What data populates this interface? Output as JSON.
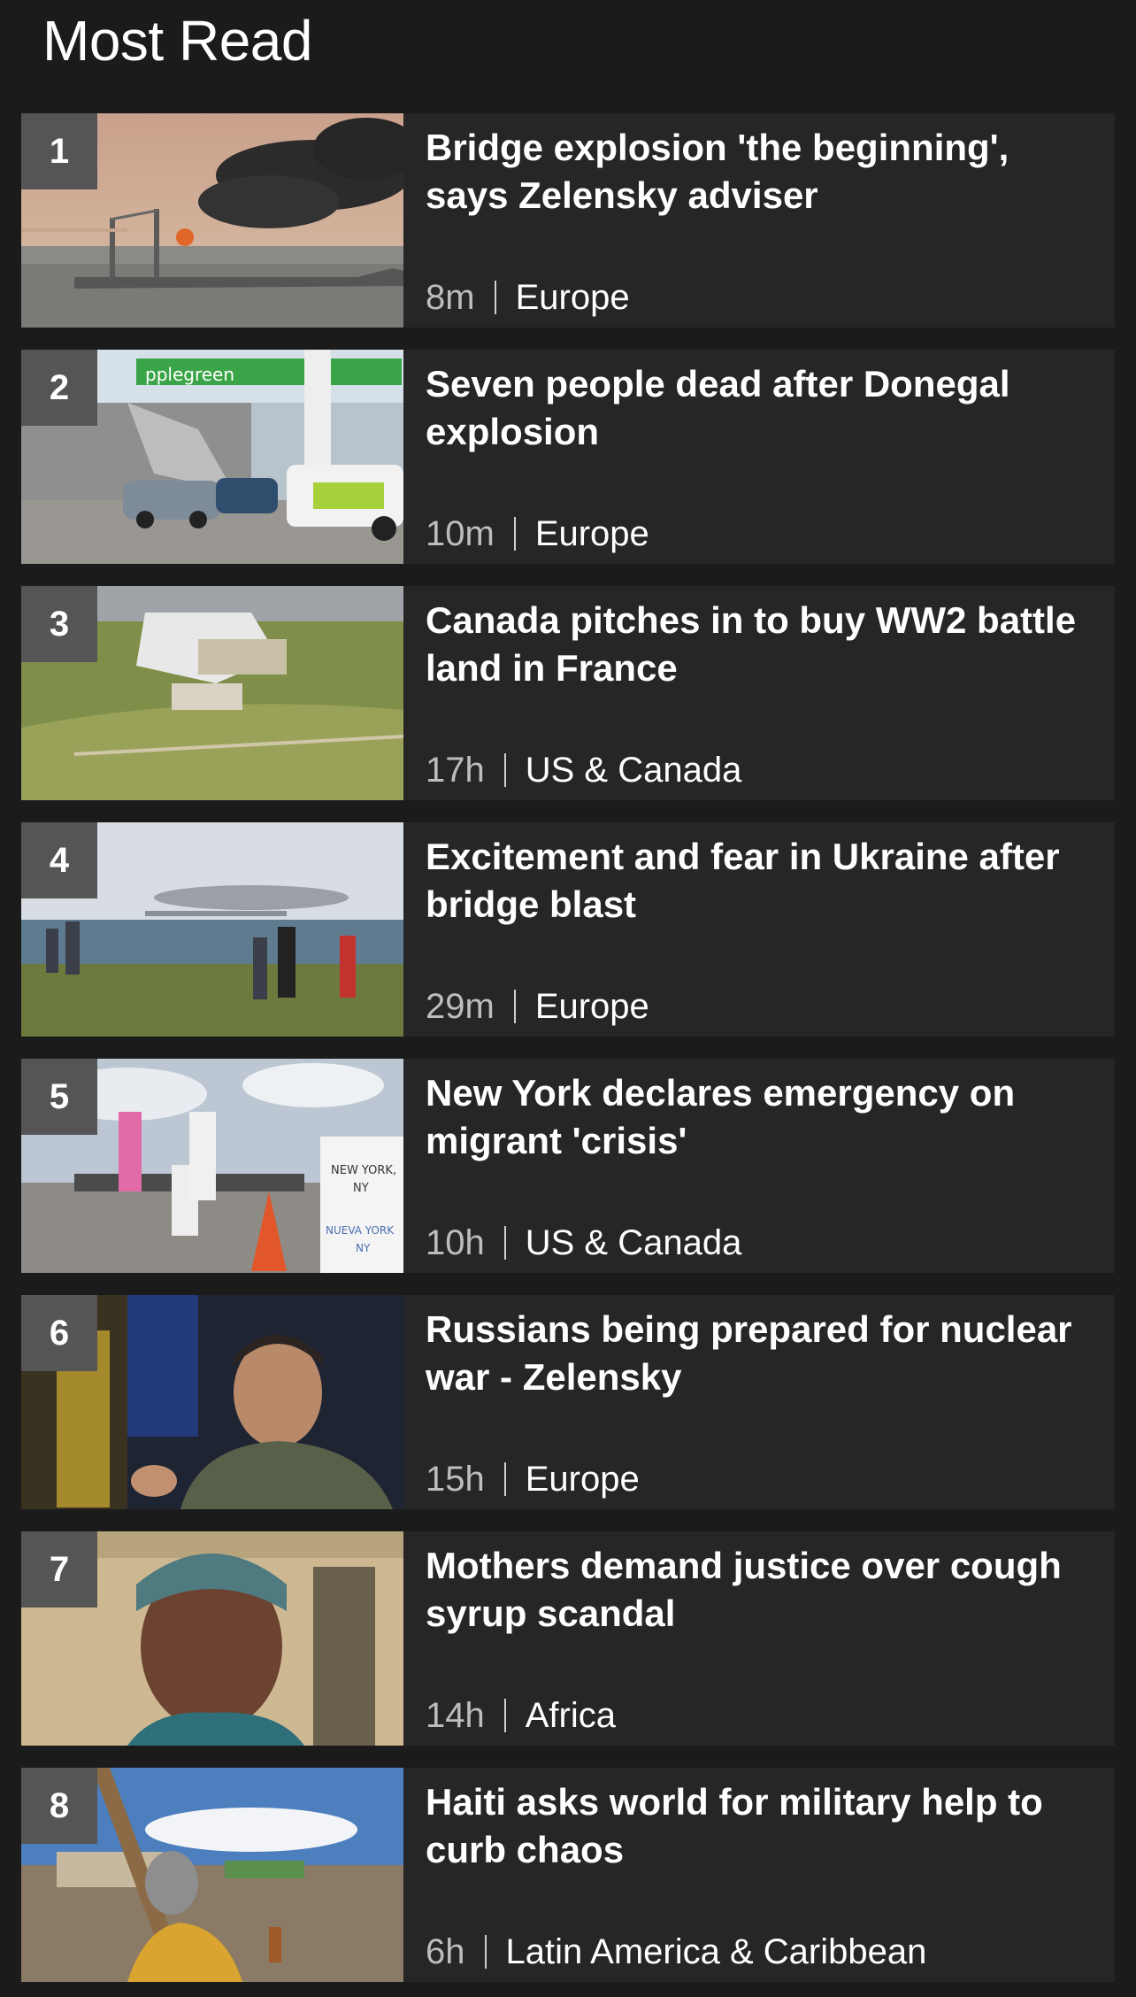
{
  "section": {
    "title": "Most Read"
  },
  "articles": [
    {
      "rank": "1",
      "headline": "Bridge explosion 'the beginning', says Zelensky adviser",
      "time": "8m",
      "category": "Europe"
    },
    {
      "rank": "2",
      "headline": "Seven people dead after Donegal explosion",
      "time": "10m",
      "category": "Europe"
    },
    {
      "rank": "3",
      "headline": "Canada pitches in to buy WW2 battle land in France",
      "time": "17h",
      "category": "US & Canada"
    },
    {
      "rank": "4",
      "headline": "Excitement and fear in Ukraine after bridge blast",
      "time": "29m",
      "category": "Europe"
    },
    {
      "rank": "5",
      "headline": "New York declares emergency on migrant 'crisis'",
      "time": "10h",
      "category": "US & Canada"
    },
    {
      "rank": "6",
      "headline": "Russians being prepared for nuclear war - Zelensky",
      "time": "15h",
      "category": "Europe"
    },
    {
      "rank": "7",
      "headline": "Mothers demand justice over cough syrup scandal",
      "time": "14h",
      "category": "Africa"
    },
    {
      "rank": "8",
      "headline": "Haiti asks world for military help to curb chaos",
      "time": "6h",
      "category": "Latin America & Caribbean"
    }
  ],
  "images": {
    "sign_applegreen": "pplegreen",
    "sign_ny_line1": "NEW YORK,",
    "sign_ny_line2": "NY",
    "sign_ny_line3": "NUEVA YORK",
    "sign_ny_line4": "NY"
  },
  "colors": {
    "background": "#1b1b1b",
    "card": "#262626",
    "rank_badge": "#555555",
    "text": "#ffffff",
    "muted_text": "#bdbdbd"
  }
}
